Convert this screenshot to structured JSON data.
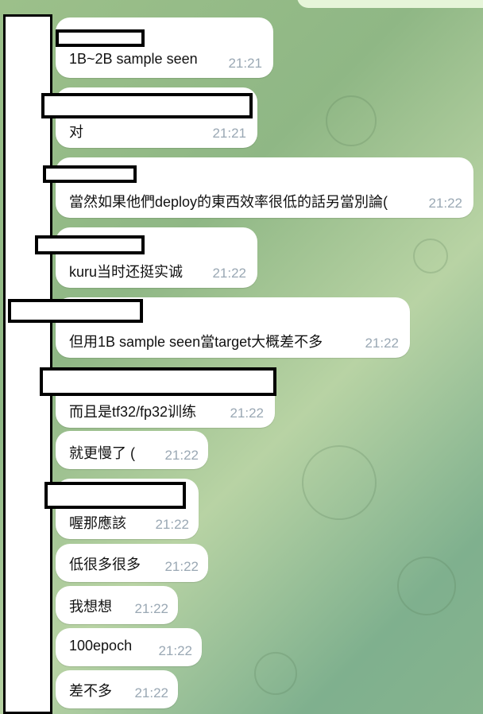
{
  "messages": [
    {
      "text": "1B~2B sample seen",
      "time": "21:21"
    },
    {
      "text": "对",
      "time": "21:21"
    },
    {
      "text": "當然如果他們deploy的東西效率很低的話另當別論(",
      "time": "21:22"
    },
    {
      "text": "kuru当时还挺实诚",
      "time": "21:22"
    },
    {
      "text": "但用1B sample seen當target大概差不多",
      "time": "21:22"
    },
    {
      "text": "而且是tf32/fp32训练",
      "time": "21:22"
    },
    {
      "text": "就更慢了 (",
      "time": "21:22"
    },
    {
      "text": "喔那應該",
      "time": "21:22"
    },
    {
      "text": "低很多很多",
      "time": "21:22"
    },
    {
      "text": "我想想",
      "time": "21:22"
    },
    {
      "text": "100epoch",
      "time": "21:22"
    },
    {
      "text": "差不多",
      "time": "21:22"
    }
  ],
  "colors": {
    "bubble": "#ffffff",
    "time": "#9aa8b4",
    "own_bubble": "#e6f5d9"
  }
}
